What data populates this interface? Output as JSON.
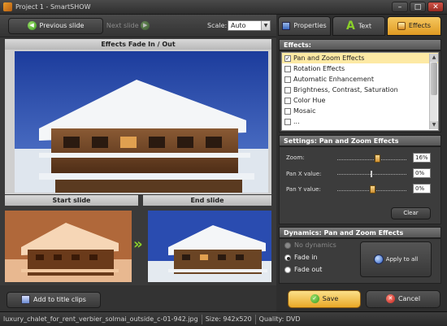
{
  "window": {
    "title": "Project 1 - SmartSHOW",
    "minimize": "–",
    "maximize": "□",
    "close": "✕"
  },
  "toolbar": {
    "previous_label": "Previous slide",
    "next_label": "Next slide",
    "scale_label": "Scale:",
    "scale_value": "Auto"
  },
  "preview": {
    "caption": "Effects Fade In / Out",
    "start_caption": "Start slide",
    "end_caption": "End slide",
    "arrow": "»"
  },
  "bottom": {
    "add_title_clips": "Add to title clips"
  },
  "statusbar": {
    "filename": "luxury_chalet_for_rent_verbier_solmai_outside_c-01-942.jpg",
    "size": "Size: 942x520",
    "quality": "Quality: DVD"
  },
  "tabs": [
    {
      "label": "Properties",
      "icon": "properties-icon"
    },
    {
      "label": "Text",
      "icon": "text-icon"
    },
    {
      "label": "Effects",
      "icon": "effects-icon",
      "active": true
    }
  ],
  "effects": {
    "heading": "Effects:",
    "items": [
      {
        "label": "Pan and Zoom Effects",
        "checked": true,
        "selected": true
      },
      {
        "label": "Rotation Effects",
        "checked": false
      },
      {
        "label": "Automatic Enhancement",
        "checked": false
      },
      {
        "label": "Brightness, Contrast, Saturation",
        "checked": false
      },
      {
        "label": "Color Hue",
        "checked": false
      },
      {
        "label": "Mosaic",
        "checked": false
      },
      {
        "label": "...",
        "checked": false
      }
    ]
  },
  "settings": {
    "heading": "Settings: Pan and Zoom Effects",
    "zoom_label": "Zoom:",
    "zoom_value": "16%",
    "zoom_level": 0.16,
    "panx_label": "Pan X value:",
    "panx_value": "0%",
    "pany_label": "Pan Y value:",
    "pany_value": "0%",
    "clear_label": "Clear"
  },
  "dynamics": {
    "heading": "Dynamics: Pan and Zoom Effects",
    "options": [
      "No dynamics",
      "Fade in",
      "Fade out"
    ],
    "apply_label": "Apply to all"
  },
  "actions": {
    "save": "Save",
    "cancel": "Cancel"
  },
  "colors": {
    "accent": "#e09a22",
    "save_bg": "#f3c14e",
    "cancel_bg": "#cf2a20"
  }
}
